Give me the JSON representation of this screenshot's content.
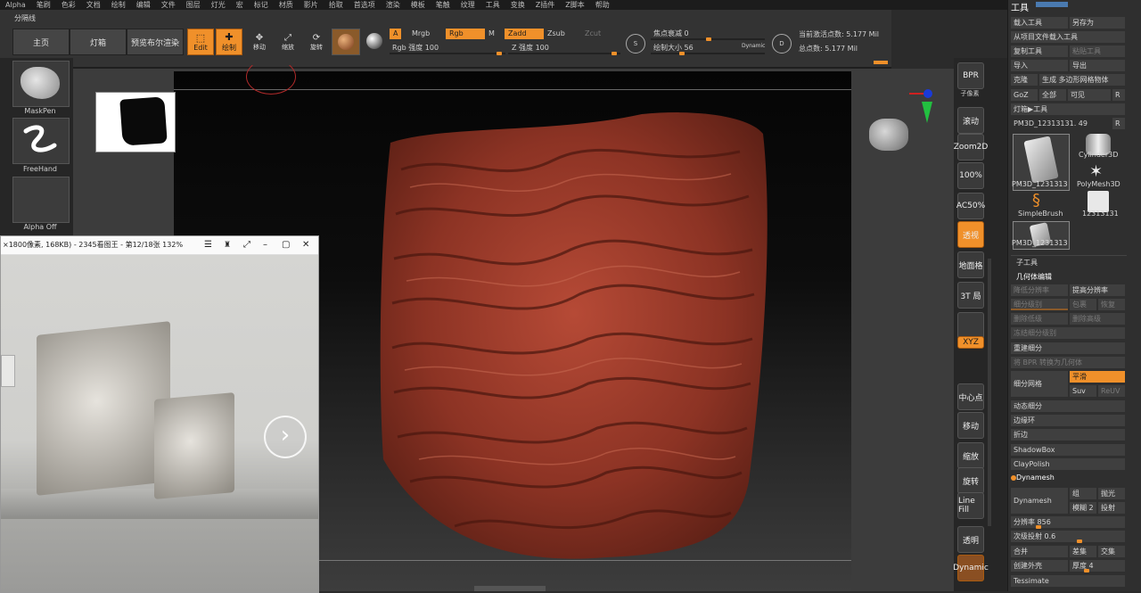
{
  "menubar": [
    "Alpha",
    "笔刷",
    "色彩",
    "文档",
    "绘制",
    "编辑",
    "文件",
    "图层",
    "灯光",
    "宏",
    "标记",
    "材质",
    "影片",
    "拾取",
    "首选项",
    "渲染",
    "模板",
    "笔触",
    "纹理",
    "工具",
    "变换",
    "Z插件",
    "Z脚本",
    "帮助"
  ],
  "toolbar": {
    "divider_label": "分隔线",
    "tabs": [
      "主页",
      "灯箱",
      "预览布尔渲染"
    ],
    "edit": "Edit",
    "draw": "绘制",
    "move": "移动",
    "scale": "缩放",
    "rotate": "旋转",
    "a_chip": "A",
    "mrgb": "Mrgb",
    "rgb": "Rgb",
    "m": "M",
    "zadd": "Zadd",
    "zsub": "Zsub",
    "zcut": "Zcut",
    "rgb_intensity": "Rgb 强度 100",
    "z_intensity": "Z 强度 100",
    "focal_shift": "焦点衰减 0",
    "draw_size": "绘制大小 56",
    "dynamic": "Dynamic",
    "s_label": "S",
    "d_label": "D",
    "active_points": "当前激活点数: 5.177 Mil",
    "total_points": "总点数: 5.177 Mil"
  },
  "left_shelf": {
    "brush1": "MaskPen",
    "brush2": "FreeHand",
    "brush3": "Alpha Off"
  },
  "viewer": {
    "title": "×1800像素, 168KB) - 2345看图王 - 第12/18张 132%",
    "next": "›"
  },
  "right_shelf": [
    {
      "name": "bpr",
      "label": "BPR"
    },
    {
      "name": "subpixel",
      "label": "子像素"
    },
    {
      "name": "scroll",
      "label": "滚动"
    },
    {
      "name": "zoom2d",
      "label": "Zoom2D"
    },
    {
      "name": "pct100",
      "label": "100%"
    },
    {
      "name": "ac50",
      "label": "AC50%"
    },
    {
      "name": "perspective",
      "label": "透视"
    },
    {
      "name": "floor",
      "label": "地面格"
    },
    {
      "name": "local",
      "label": "3T 局"
    },
    {
      "name": "lock",
      "label": ""
    },
    {
      "name": "xyz",
      "label": "XYZ"
    },
    {
      "name": "center",
      "label": "中心点"
    },
    {
      "name": "move",
      "label": "移动"
    },
    {
      "name": "scale",
      "label": "缩放"
    },
    {
      "name": "rotate",
      "label": "旋转"
    },
    {
      "name": "polyf",
      "label": "PolyF"
    },
    {
      "name": "linefill",
      "label": "Line Fill"
    },
    {
      "name": "transp",
      "label": "透明"
    },
    {
      "name": "dynamic",
      "label": "Dynamic"
    }
  ],
  "tool_panel": {
    "title": "工具",
    "load_tool": "载入工具",
    "save_as": "另存为",
    "load_from_project": "从项目文件载入工具",
    "copy_tool": "复制工具",
    "paste_tool": "粘贴工具",
    "import": "导入",
    "export": "导出",
    "clone": "克隆",
    "make_polymesh": "生成 多边形网格物体",
    "goz": "GoZ",
    "all": "全部",
    "visible": "可见",
    "r": "R",
    "lightbox_tools": "灯箱▶工具",
    "current_tool": "PM3D_12313131. 49",
    "thumbs": [
      "PM3D_1231313",
      "Cylinder3D",
      "PolyMesh3D",
      "SimpleBrush",
      "12313131",
      "PM3D_1231313"
    ],
    "subtool": "子工具",
    "geometry": "几何体编辑",
    "lower_res": "降低分辨率",
    "higher_res": "提高分辨率",
    "sdiv": "细分级别",
    "cage": "包裹",
    "rstr": "恢复",
    "del_lower": "删除低级",
    "del_higher": "删除高级",
    "freeze_sub": "冻结细分级别",
    "reconstruct": "重建细分",
    "convert_bpr": "将 BPR 转换为几何体",
    "divide": "细分网格",
    "smooth": "平滑",
    "suv": "Suv",
    "reuv": "ReUV",
    "dynamic_sub": "动态细分",
    "edge_loop": "边缘环",
    "crease": "折边",
    "shadowbox": "ShadowBox",
    "claypolish": "ClayPolish",
    "dynamesh_header": "Dynamesh",
    "dynamesh": "Dynamesh",
    "group": "组",
    "polish": "抛光",
    "blur": "模糊 2",
    "project": "投射",
    "resolution": "分辨率 856",
    "subproject": "次级投射 0.6",
    "merge": "合并",
    "diff": "差集",
    "intersect": "交集",
    "shell": "创建外壳",
    "thickness": "厚度 4",
    "tessimate": "Tessimate"
  },
  "colors": {
    "accent": "#f0902a",
    "clay": "#9b3a2a",
    "bg": "#2b2b2b"
  }
}
